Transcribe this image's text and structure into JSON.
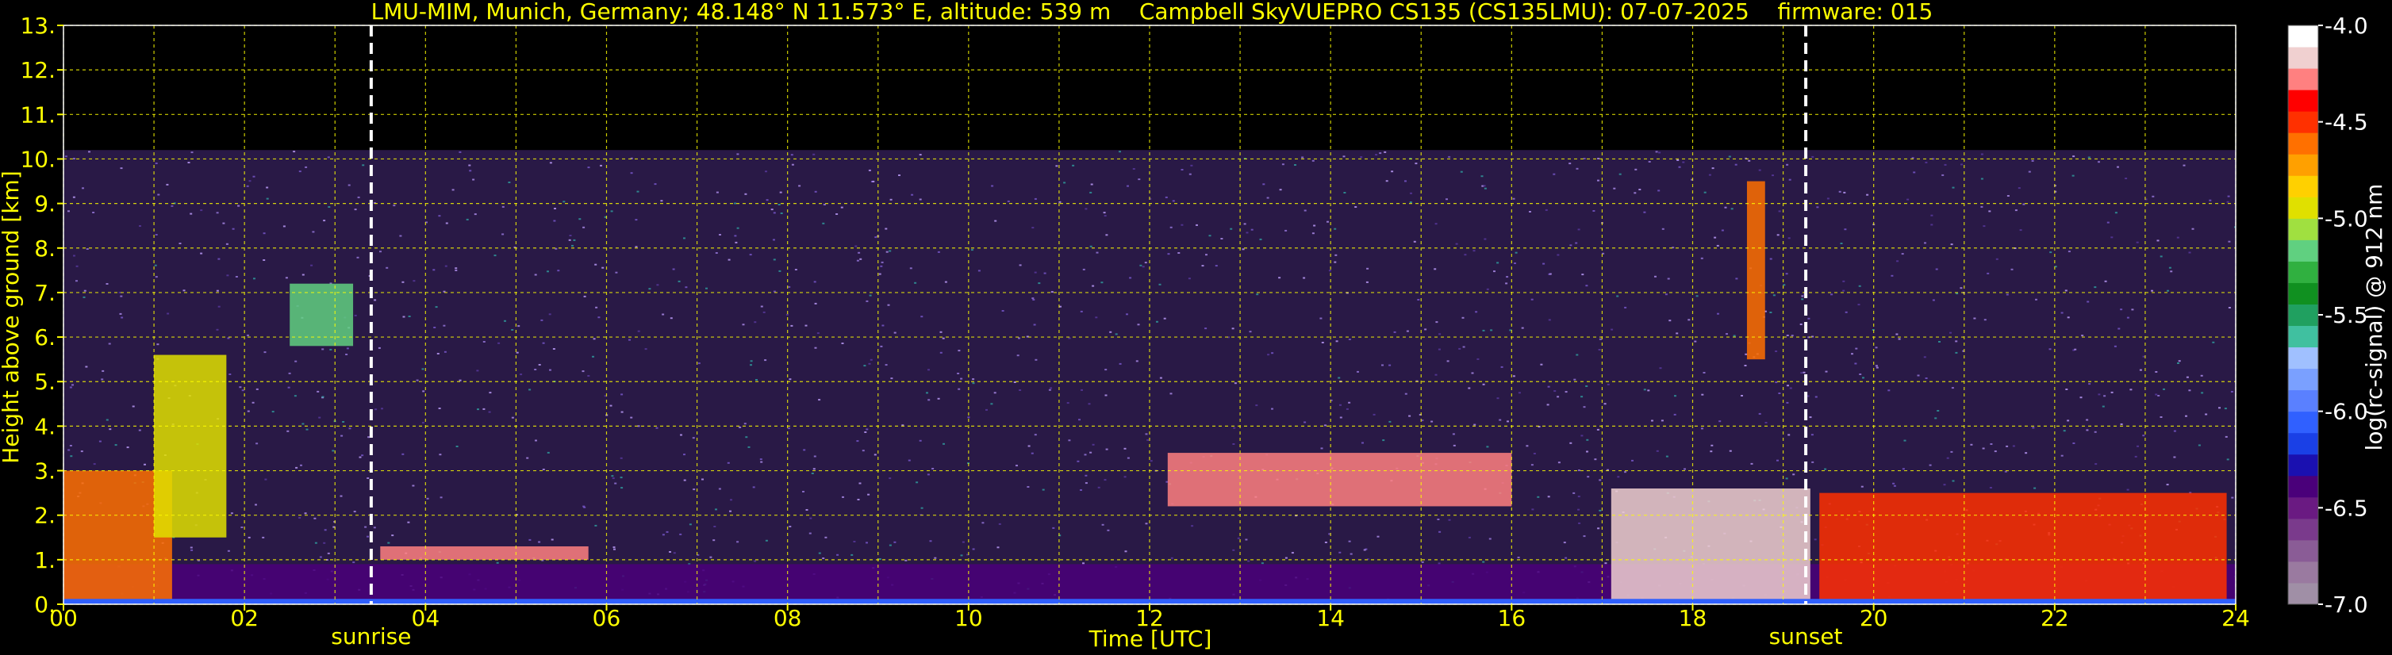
{
  "chart_data": {
    "type": "heatmap",
    "title": "LMU-MIM, Munich, Germany; 48.148° N 11.573° E, altitude: 539 m    Campbell SkyVUEPRO CS135 (CS135LMU): 07-07-2025    firmware: 015",
    "xlabel": "Time [UTC]",
    "ylabel": "Height above ground [km]",
    "xlim": [
      0,
      24
    ],
    "ylim": [
      0,
      13
    ],
    "x_ticks": [
      "00",
      "02",
      "04",
      "06",
      "08",
      "10",
      "12",
      "14",
      "16",
      "18",
      "20",
      "22",
      "24"
    ],
    "y_ticks": [
      "0.",
      "1.",
      "2.",
      "3.",
      "4.",
      "5.",
      "6.",
      "7.",
      "8.",
      "9.",
      "10.",
      "11.",
      "12.",
      "13."
    ],
    "grid": true,
    "grid_color": "#ffff00",
    "background_color": "#000000",
    "signal_top_km": 10.2,
    "markers": [
      {
        "label": "sunrise",
        "time_utc": 3.4
      },
      {
        "label": "sunset",
        "time_utc": 19.25
      }
    ],
    "colorbar": {
      "label": "log(rc-signal) @ 912 nm",
      "range": [
        -7.0,
        -4.0
      ],
      "tick_labels": [
        "-4.0",
        "-4.5",
        "-5.0",
        "-5.5",
        "-6.0",
        "-6.5",
        "-7.0"
      ],
      "tick_values": [
        -4.0,
        -4.5,
        -5.0,
        -5.5,
        -6.0,
        -6.5,
        -7.0
      ],
      "colors": [
        "#a08fa6",
        "#9a7aa0",
        "#8a5c96",
        "#7a3a8c",
        "#6a1a82",
        "#4a007a",
        "#1a10b0",
        "#1a40e6",
        "#3060ff",
        "#5a80ff",
        "#7aa0ff",
        "#a0c0ff",
        "#40c0a0",
        "#20a060",
        "#109020",
        "#30b040",
        "#60d080",
        "#a0e040",
        "#e0e000",
        "#ffd000",
        "#ffa000",
        "#ff7000",
        "#ff3000",
        "#ff0000",
        "#ff8080",
        "#f0d0d0",
        "#ffffff"
      ]
    },
    "features": [
      {
        "name": "aerosol layer",
        "t_start": 0,
        "t_end": 24,
        "z_bottom": 0.0,
        "z_top": 0.9,
        "level": -6.4
      },
      {
        "name": "morning high signal",
        "t_start": 0,
        "t_end": 1.2,
        "z_bottom": 0.0,
        "z_top": 3.0,
        "level": -4.6
      },
      {
        "name": "morning rising layer",
        "t_start": 1.0,
        "t_end": 1.8,
        "z_bottom": 1.5,
        "z_top": 5.6,
        "level": -5.0
      },
      {
        "name": "cloud patch",
        "t_start": 2.5,
        "t_end": 3.2,
        "z_bottom": 5.8,
        "z_top": 7.2,
        "level": -5.2
      },
      {
        "name": "boundary layer top (morning)",
        "t_start": 3.5,
        "t_end": 5.8,
        "z_bottom": 1.0,
        "z_top": 1.3,
        "level": -4.3
      },
      {
        "name": "boundary layer top (midday)",
        "t_start": 12.2,
        "t_end": 16.0,
        "z_bottom": 2.2,
        "z_top": 3.4,
        "level": -4.3
      },
      {
        "name": "afternoon clouds",
        "t_start": 17.1,
        "t_end": 19.3,
        "z_bottom": 0.0,
        "z_top": 2.6,
        "level": -4.2
      },
      {
        "name": "thin cirrus column",
        "t_start": 18.6,
        "t_end": 18.8,
        "z_bottom": 5.5,
        "z_top": 9.5,
        "level": -4.6
      },
      {
        "name": "evening clouds",
        "t_start": 19.4,
        "t_end": 23.9,
        "z_bottom": 0.0,
        "z_top": 2.5,
        "level": -4.5
      }
    ]
  }
}
